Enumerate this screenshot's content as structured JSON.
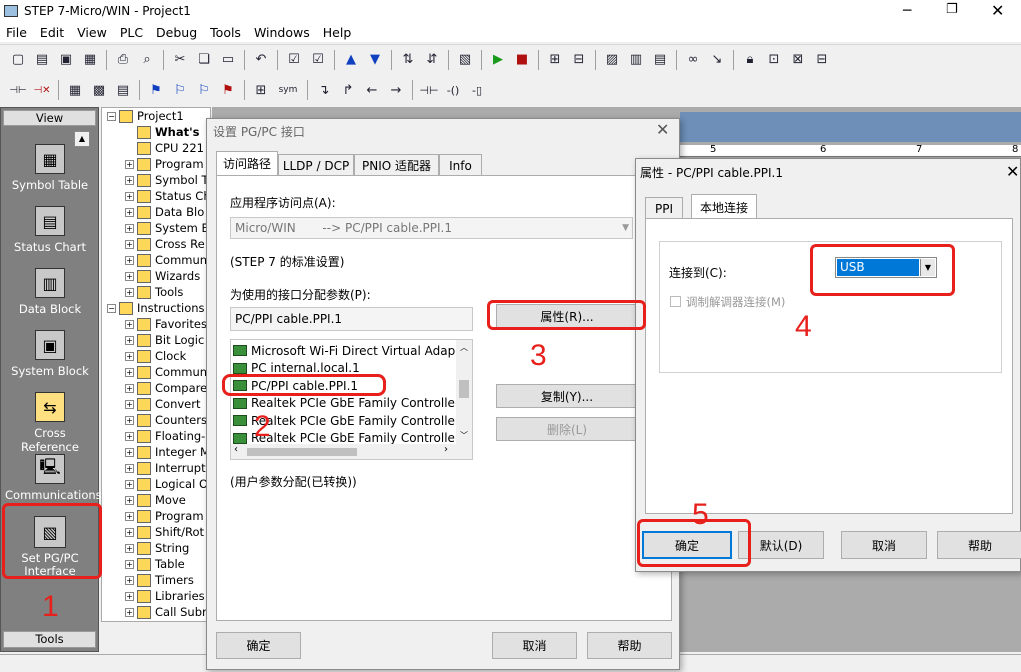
{
  "app": {
    "title": "STEP 7-Micro/WIN - Project1"
  },
  "menu": [
    "File",
    "Edit",
    "View",
    "PLC",
    "Debug",
    "Tools",
    "Windows",
    "Help"
  ],
  "toolbar": {
    "sym_label": "sym"
  },
  "nav": {
    "header": "View",
    "footer": "Tools",
    "items": [
      "Symbol Table",
      "Status Chart",
      "Data Block",
      "System Block",
      "Cross Reference",
      "Communications",
      "Set PG/PC Interface"
    ]
  },
  "tree": {
    "items": [
      "Project1",
      "What's",
      "CPU 221",
      "Program",
      "Symbol T",
      "Status Ch",
      "Data Blo",
      "System B",
      "Cross Re",
      "Communi",
      "Wizards",
      "Tools",
      "Instructions",
      "Favorites",
      "Bit Logic",
      "Clock",
      "Communi",
      "Compare",
      "Convert",
      "Counters",
      "Floating-P",
      "Integer M",
      "Interrupt",
      "Logical O",
      "Move",
      "Program",
      "Shift/Rot",
      "String",
      "Table",
      "Timers",
      "Libraries",
      "Call Subr"
    ]
  },
  "ruler": {
    "marks": [
      "5",
      "6",
      "7",
      "8"
    ]
  },
  "dlg1": {
    "title": "设置 PG/PC 接口",
    "tabs": [
      "访问路径",
      "LLDP / DCP",
      "PNIO 适配器",
      "Info"
    ],
    "access_point_label": "应用程序访问点(A):",
    "access_point_value": "Micro/WIN       --> PC/PPI cable.PPI.1",
    "std_note": "(STEP 7 的标准设置)",
    "param_label": "为使用的接口分配参数(P):",
    "param_value": "PC/PPI cable.PPI.1",
    "list": [
      "Microsoft Wi-Fi Direct Virtual Adap",
      "PC internal.local.1",
      "PC/PPI cable.PPI.1",
      "Realtek PCIe GbE Family Controller",
      "Realtek PCIe GbE Family Controller",
      "Realtek PCIe GbE Family Controller"
    ],
    "props_btn": "属性(R)...",
    "copy_btn": "复制(Y)...",
    "delete_btn": "删除(L)",
    "user_note": "(用户参数分配(已转换))",
    "ok": "确定",
    "cancel": "取消",
    "help": "帮助"
  },
  "dlg2": {
    "title": "属性 - PC/PPI cable.PPI.1",
    "tabs": [
      "PPI",
      "本地连接"
    ],
    "connect_label": "连接到(C):",
    "connect_value": "USB",
    "modem_label": "调制解调器连接(M)",
    "ok": "确定",
    "default": "默认(D)",
    "cancel": "取消",
    "help": "帮助"
  },
  "annotations": [
    "1",
    "2",
    "3",
    "4",
    "5"
  ],
  "colors": {
    "annotation": "#e8201c",
    "nav_bg": "#808080",
    "select": "#0078d7"
  }
}
